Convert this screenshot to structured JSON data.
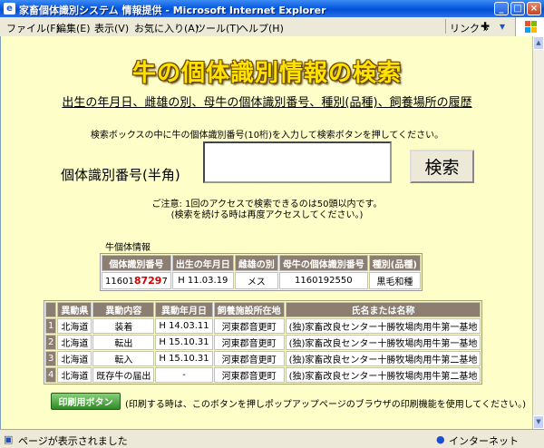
{
  "window": {
    "title": "家畜個体識別システム 情報提供 - Microsoft Internet Explorer",
    "minimize": "_",
    "maximize": "□",
    "close": "×"
  },
  "menu": {
    "items": [
      "ファイル(F)",
      "編集(E)",
      "表示(V)",
      "お気に入り(A)",
      "ツール(T)",
      "ヘルプ(H)"
    ],
    "link_label": "リンク",
    "link_arrow": "»"
  },
  "page": {
    "banner": "牛の個体識別情報の検索",
    "subtitle": "出生の年月日、雌雄の別、母牛の個体識別番号、種別(品種)、飼養場所の履歴",
    "instruction": "検索ボックスの中に牛の個体識別番号(10桁)を入力して検索ボタンを押してください。",
    "id_label": "個体識別番号(半角)",
    "id_value": "",
    "search_button": "検索",
    "notice_line1": "ご注意: 1回のアクセスで検索できるのは50頭以内です。",
    "notice_line2": "(検索を続ける時は再度アクセスしてください。)"
  },
  "cattle_info": {
    "caption": "牛個体情報",
    "headers": [
      "個体識別番号",
      "出生の年月日",
      "雌雄の別",
      "母牛の個体識別番号",
      "種別(品種)"
    ],
    "row": {
      "id_prefix": "11601",
      "id_highlight": "8729",
      "id_suffix": "7",
      "birth_date": "H 11.03.19",
      "sex": "メス",
      "mother_id": "1160192550",
      "breed": "黒毛和種"
    }
  },
  "history": {
    "headers": [
      "異動県",
      "異動内容",
      "異動年月日",
      "飼養施設所在地",
      "氏名または名称"
    ],
    "rows": [
      {
        "no": "1",
        "pref": "北海道",
        "event": "装着",
        "date": "H 14.03.11",
        "address": "河東郡音更町",
        "name": "(独)家畜改良センター十勝牧場肉用牛第一基地"
      },
      {
        "no": "2",
        "pref": "北海道",
        "event": "転出",
        "date": "H 15.10.31",
        "address": "河東郡音更町",
        "name": "(独)家畜改良センター十勝牧場肉用牛第一基地"
      },
      {
        "no": "3",
        "pref": "北海道",
        "event": "転入",
        "date": "H 15.10.31",
        "address": "河東郡音更町",
        "name": "(独)家畜改良センター十勝牧場肉用牛第二基地"
      },
      {
        "no": "4",
        "pref": "北海道",
        "event": "既存牛の届出",
        "date": "-",
        "address": "河東郡音更町",
        "name": "(独)家畜改良センター十勝牧場肉用牛第二基地"
      }
    ]
  },
  "print": {
    "button": "印刷用ボタン",
    "note": "(印刷する時は、このボタンを押しポップアップページのブラウザの印刷機能を使用してください。)"
  },
  "status": {
    "text": "ページが表示されました",
    "zone": "インターネット"
  }
}
